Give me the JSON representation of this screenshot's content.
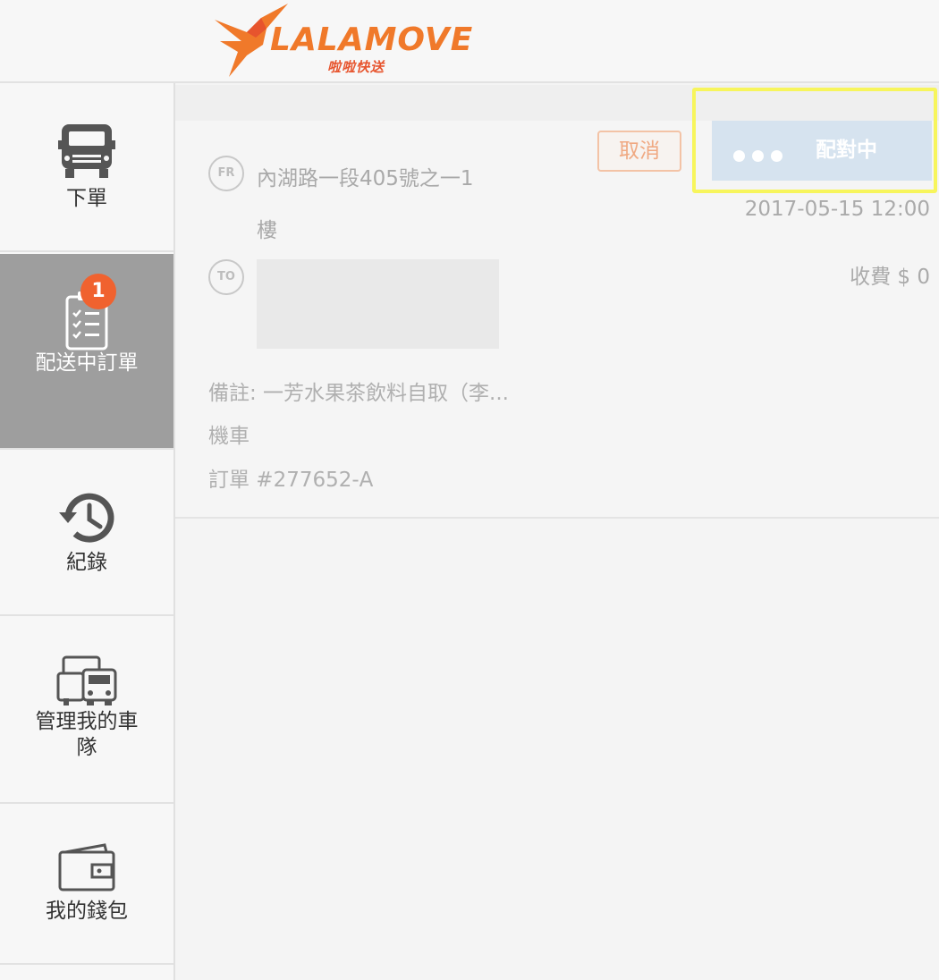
{
  "brand": {
    "name": "LALAMOVE",
    "subtitle": "啦啦快送",
    "colors": {
      "primary": "#f0792a",
      "accent": "#e7542d"
    }
  },
  "sidebar": {
    "items": [
      {
        "label": "下單",
        "icon": "van-icon",
        "active": false
      },
      {
        "label": "配送中訂單",
        "icon": "clipboard-checklist-icon",
        "active": true,
        "badge": "1"
      },
      {
        "label": "紀錄",
        "icon": "history-clock-icon",
        "active": false
      },
      {
        "label": "管理我的車隊",
        "icon": "fleet-vehicles-icon",
        "active": false
      },
      {
        "label": "我的錢包",
        "icon": "wallet-icon",
        "active": false
      }
    ]
  },
  "order": {
    "from_tag": "FR",
    "to_tag": "TO",
    "from_address_line1": "內湖路一段405號之一1",
    "from_address_line2": "樓",
    "remark": "備註: 一芳水果茶飲料自取（李...",
    "vehicle": "機車",
    "order_number": "訂單 #277652-A",
    "cancel_label": "取消",
    "status_label": "配對中",
    "datetime": "2017-05-15 12:00",
    "fee": "收費 $ 0"
  }
}
